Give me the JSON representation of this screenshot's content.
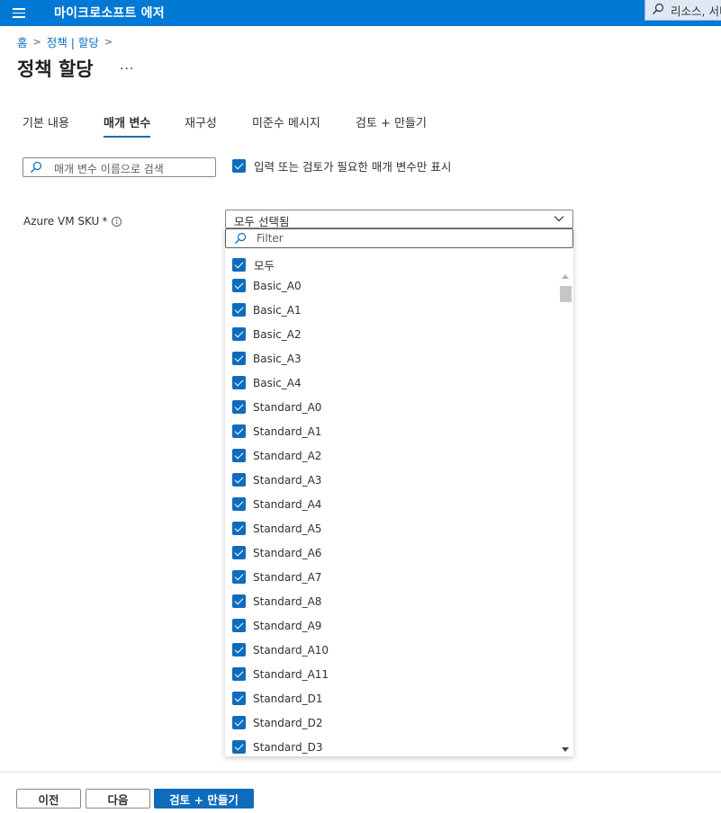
{
  "topbar": {
    "brand": "마이크로소프트 에저",
    "search_text": "리소스, 서비"
  },
  "breadcrumb": {
    "home": "홈",
    "policy": "정책 | 할당"
  },
  "page": {
    "title": "정책 할당",
    "more": "..."
  },
  "tabs": [
    {
      "label": "기본 내용",
      "active": false
    },
    {
      "label": "매개 변수",
      "active": true
    },
    {
      "label": "재구성",
      "active": false
    },
    {
      "label": "미준수 메시지",
      "active": false
    },
    {
      "label": "검토 + 만들기",
      "active": false
    }
  ],
  "param_search": {
    "placeholder": "매개 변수 이름으로 검색"
  },
  "only_required_filter": {
    "label": "입력 또는 검토가 필요한 매개 변수만 표시",
    "checked": true
  },
  "field": {
    "label": "Azure VM SKU",
    "required": "*",
    "info": "i"
  },
  "dropdown": {
    "value": "모두 선택됨",
    "filter_placeholder": "Filter",
    "select_all_label": "모두",
    "options": [
      "Basic_A0",
      "Basic_A1",
      "Basic_A2",
      "Basic_A3",
      "Basic_A4",
      "Standard_A0",
      "Standard_A1",
      "Standard_A2",
      "Standard_A3",
      "Standard_A4",
      "Standard_A5",
      "Standard_A6",
      "Standard_A7",
      "Standard_A8",
      "Standard_A9",
      "Standard_A10",
      "Standard_A11",
      "Standard_D1",
      "Standard_D2",
      "Standard_D3"
    ]
  },
  "footer": {
    "prev": "이전",
    "next": "다음",
    "review": "검토 + 만들기"
  },
  "colors": {
    "topbar": "#0078d4",
    "accent": "#0f6cbd"
  }
}
